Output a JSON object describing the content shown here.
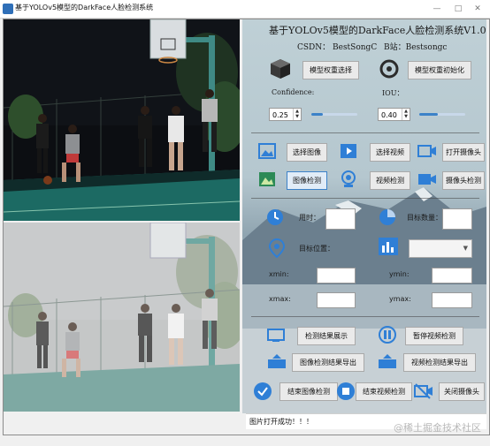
{
  "window": {
    "title": "基于YOLOv5模型的DarkFace人脸检测系统"
  },
  "header": {
    "title": "基于YOLOv5模型的DarkFace人脸检测系统V1.0",
    "csdn": "CSDN：  BestSongC",
    "bilibili": "B站：Bestsongc"
  },
  "model": {
    "select_label": "模型权重选择",
    "init_label": "模型权重初始化"
  },
  "confidence": {
    "label": "Confidence:",
    "value": "0.25",
    "level": 0.25
  },
  "iou": {
    "label": "IOU：",
    "value": "0.40",
    "level": 0.4
  },
  "media_buttons": {
    "select_image": "选择图像",
    "select_video": "选择视频",
    "open_camera": "打开摄像头",
    "image_detect": "图像检测",
    "video_detect": "视频检测",
    "camera_detect": "摄像头检测"
  },
  "results": {
    "time_label": "用时：",
    "count_label": "目标数量：",
    "position_label": "目标位置：",
    "xmin": "xmin:",
    "ymin": "ymin:",
    "xmax": "xmax:",
    "ymax": "ymax:"
  },
  "actions": {
    "show_results": "检测结果展示",
    "pause_video": "暂停视频检测",
    "export_image": "图像检测结果导出",
    "export_video": "视频检测结果导出",
    "end_image": "结束图像检测",
    "end_video": "结束视频检测",
    "close_camera": "关闭摄像头"
  },
  "status": {
    "message": "图片打开成功！！！"
  },
  "watermark": "@稀土掘金技术社区",
  "colors": {
    "accent": "#3c82c8",
    "icon_blue": "#2f7fd6"
  }
}
